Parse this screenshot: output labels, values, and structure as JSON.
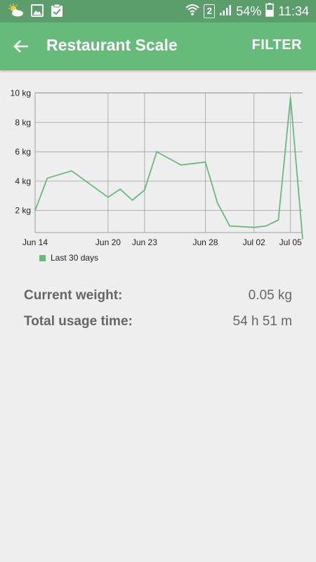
{
  "status_bar": {
    "battery": "54%",
    "time": "11:34",
    "sim_slot": "2",
    "icons": [
      "weather-icon",
      "gallery-icon",
      "clipboard-icon",
      "wifi-icon",
      "signal-icon",
      "battery-icon"
    ]
  },
  "app_bar": {
    "title": "Restaurant Scale",
    "filter_label": "FILTER",
    "back_icon": "arrow-left-icon",
    "color": "#66BB7A"
  },
  "chart_data": {
    "type": "line",
    "title": "",
    "xlabel": "",
    "ylabel": "",
    "x_tick_labels": [
      "Jun 14",
      "Jun 20",
      "Jun 23",
      "Jun 28",
      "Jul 02",
      "Jul 05"
    ],
    "y_tick_labels": [
      "2 kg",
      "4 kg",
      "6 kg",
      "8 kg",
      "10 kg"
    ],
    "ylim": [
      0.5,
      10.5
    ],
    "grid": true,
    "legend_position": "bottom-left",
    "series": [
      {
        "name": "Last 30 days",
        "color": "#66BB7A",
        "points": [
          {
            "x": "Jun 14",
            "y": 2.0
          },
          {
            "x": "Jun 15",
            "y": 4.2
          },
          {
            "x": "Jun 17",
            "y": 4.7
          },
          {
            "x": "Jun 20",
            "y": 2.9
          },
          {
            "x": "Jun 21",
            "y": 3.45
          },
          {
            "x": "Jun 22",
            "y": 2.7
          },
          {
            "x": "Jun 23",
            "y": 3.4
          },
          {
            "x": "Jun 24",
            "y": 6.0
          },
          {
            "x": "Jun 26",
            "y": 5.1
          },
          {
            "x": "Jun 28",
            "y": 5.3
          },
          {
            "x": "Jun 29",
            "y": 2.5
          },
          {
            "x": "Jun 30",
            "y": 0.95
          },
          {
            "x": "Jul 02",
            "y": 0.85
          },
          {
            "x": "Jul 03",
            "y": 0.95
          },
          {
            "x": "Jul 04",
            "y": 1.35
          },
          {
            "x": "Jul 05",
            "y": 9.7
          },
          {
            "x": "Jul 06",
            "y": 0.05
          }
        ]
      }
    ]
  },
  "info": {
    "current_weight_label": "Current weight:",
    "current_weight_value": "0.05 kg",
    "total_usage_label": "Total usage time:",
    "total_usage_value": "54 h 51 m"
  }
}
